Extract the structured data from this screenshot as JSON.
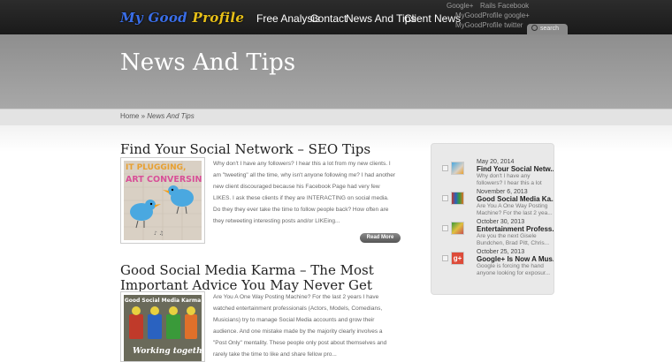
{
  "header": {
    "logo_part1": "My Good",
    "logo_part2": "Profile",
    "nav": [
      "Free Analysis",
      "Contact",
      "News And Tips",
      "Client News"
    ],
    "social": [
      "Google+",
      "Rails Facebook",
      "MyGoodProfile google+",
      "MyGoodProfile twitter"
    ],
    "search_label": "search"
  },
  "page_title": "News And Tips",
  "breadcrumb": {
    "home": "Home",
    "sep": "»",
    "current": "News And Tips"
  },
  "posts": [
    {
      "title": "Find Your Social Network – SEO Tips",
      "excerpt": [
        "Why don't I have any followers? I hear this a lot from my new clients. I",
        "am \"tweeting\" all the time, why isn't anyone following me? I had another",
        "new client discouraged because his Facebook Page had very few",
        "LIKES. I ask these clients if they are INTERACTING on social media.",
        "Do they they ever take the time to follow people back? How often are",
        "they retweeting interesting posts and/or LIKEing..."
      ],
      "read_more": "Read More",
      "image_text": [
        "IT PLUGGING,",
        "ART CONVERSING"
      ]
    },
    {
      "title": "Good Social Media Karma – The Most Important Advice You May Never Get",
      "excerpt": [
        "Are You A One Way Posting Machine? For the last 2 years I have",
        "watched entertainment professionals (Actors, Models, Comedians,",
        "Musicians) try to manage Social Media accounts and grow their",
        "audience. And one mistake made by the majority clearly involves a",
        "\"Post Only\" mentality. These people only post about themselves and",
        "rarely take the time to like and share fellow pro..."
      ],
      "image_text": [
        "Good Social Media Karma",
        "Working together"
      ]
    }
  ],
  "sidebar": [
    {
      "date": "May 20, 2014",
      "title": "Find Your Social Netw...",
      "excerpt": [
        "Why don't I have any",
        "followers? I hear this a lot"
      ]
    },
    {
      "date": "November 6, 2013",
      "title": "Good Social Media Ka...",
      "excerpt": [
        "Are You A One Way Posting",
        "Machine? For the last 2 yea..."
      ]
    },
    {
      "date": "October 30, 2013",
      "title": "Entertainment Profess...",
      "excerpt": [
        "Are you the next Gisele",
        "Bundchen, Brad Pitt, Chris..."
      ]
    },
    {
      "date": "October 25, 2013",
      "title": "Google+ Is Now A Mus...",
      "excerpt": [
        "Google is forcing the hand",
        "anyone looking for exposur..."
      ]
    }
  ],
  "colors": {
    "logo_blue": "#3a6ee8",
    "logo_yellow": "#e8c018",
    "topbar": "#1a1a1a",
    "band": "#9a9a9a"
  }
}
